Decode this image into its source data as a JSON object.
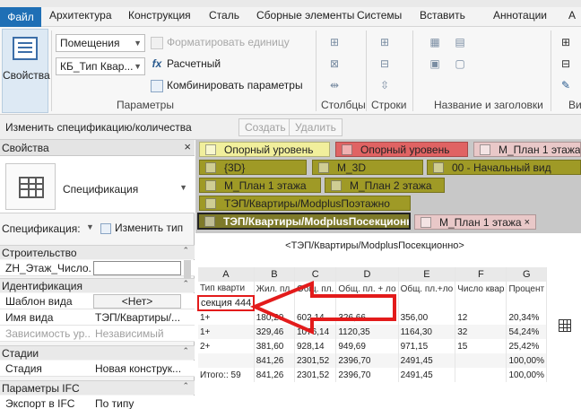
{
  "menu": {
    "tabs": [
      "Файл",
      "Архитектура",
      "Конструкция",
      "Сталь",
      "Сборные элементы",
      "Системы",
      "Вставить",
      "Аннотации",
      "А"
    ]
  },
  "ribbon": {
    "properties_label": "Свойства",
    "category_combo": "Помещения",
    "type_combo": "КБ_Тип Квар...",
    "format_unit": "Форматировать единицу",
    "calculated": "Расчетный",
    "combine_params": "Комбинировать параметры",
    "groups": [
      "Параметры",
      "Столбцы",
      "Строки",
      "Название и заголовки",
      "Ви"
    ]
  },
  "context": {
    "label": "Изменить спецификацию/количества",
    "create": "Создать",
    "delete": "Удалить"
  },
  "properties": {
    "title": "Свойства",
    "close": "×",
    "type_name": "Спецификация",
    "selector_label": "Спецификация:",
    "edit_type": "Изменить тип",
    "sections": {
      "construction": "Строительство",
      "identification": "Идентификация",
      "stages": "Стадии",
      "ifc": "Параметры IFC"
    },
    "rows": {
      "floor_num_key": "ZH_Этаж_Число...",
      "view_template_key": "Шаблон вида",
      "view_template_val": "<Нет>",
      "view_name_key": "Имя вида",
      "view_name_val": "ТЭП/Квартиры/...",
      "dependency_key": "Зависимость ур...",
      "dependency_val": "Независимый",
      "stage_key": "Стадия",
      "stage_val": "Новая конструк...",
      "ifc_export_key": "Экспорт в IFC",
      "ifc_export_val": "По типу"
    }
  },
  "tabs": {
    "row1": [
      "Опорный уровень",
      "Опорный уровень",
      "М_План 1 этажа"
    ],
    "row2": [
      "{3D}",
      "М_3D",
      "00 - Начальный вид"
    ],
    "row3": [
      "М_План 1 этажа",
      "М_План 2 этажа"
    ],
    "row4": [
      "ТЭП/Квартиры/ModplusПоэтажно"
    ],
    "row5": [
      "ТЭП/Квартиры/ModplusПосекционно",
      "М_План 1 этажа"
    ],
    "close": "×"
  },
  "schedule": {
    "title": "<ТЭП/Квартиры/ModplusПосекционно>",
    "letters": [
      "A",
      "B",
      "C",
      "D",
      "E",
      "F",
      "G"
    ],
    "names": [
      "Тип кварти",
      "Жил. пл.",
      "Общ. пл.",
      "Общ. пл. + ло",
      "Общ. пл.+ло",
      "Число квар",
      "Процент"
    ],
    "section": "секция 444",
    "rows": [
      [
        "1+",
        "180,20",
        "602,14",
        "326,66",
        "356,00",
        "12",
        "20,34%"
      ],
      [
        "1+",
        "329,46",
        "1076,14",
        "1120,35",
        "1164,30",
        "32",
        "54,24%"
      ],
      [
        "2+",
        "381,60",
        "928,14",
        "949,69",
        "971,15",
        "15",
        "25,42%"
      ],
      [
        "",
        "841,26",
        "2301,52",
        "2396,70",
        "2491,45",
        "",
        "100,00%"
      ],
      [
        "Итого:: 59",
        "841,26",
        "2301,52",
        "2396,70",
        "2491,45",
        "",
        "100,00%"
      ]
    ]
  },
  "colors": {
    "accent": "#1f6fb5",
    "highlight": "#e31b1b"
  }
}
